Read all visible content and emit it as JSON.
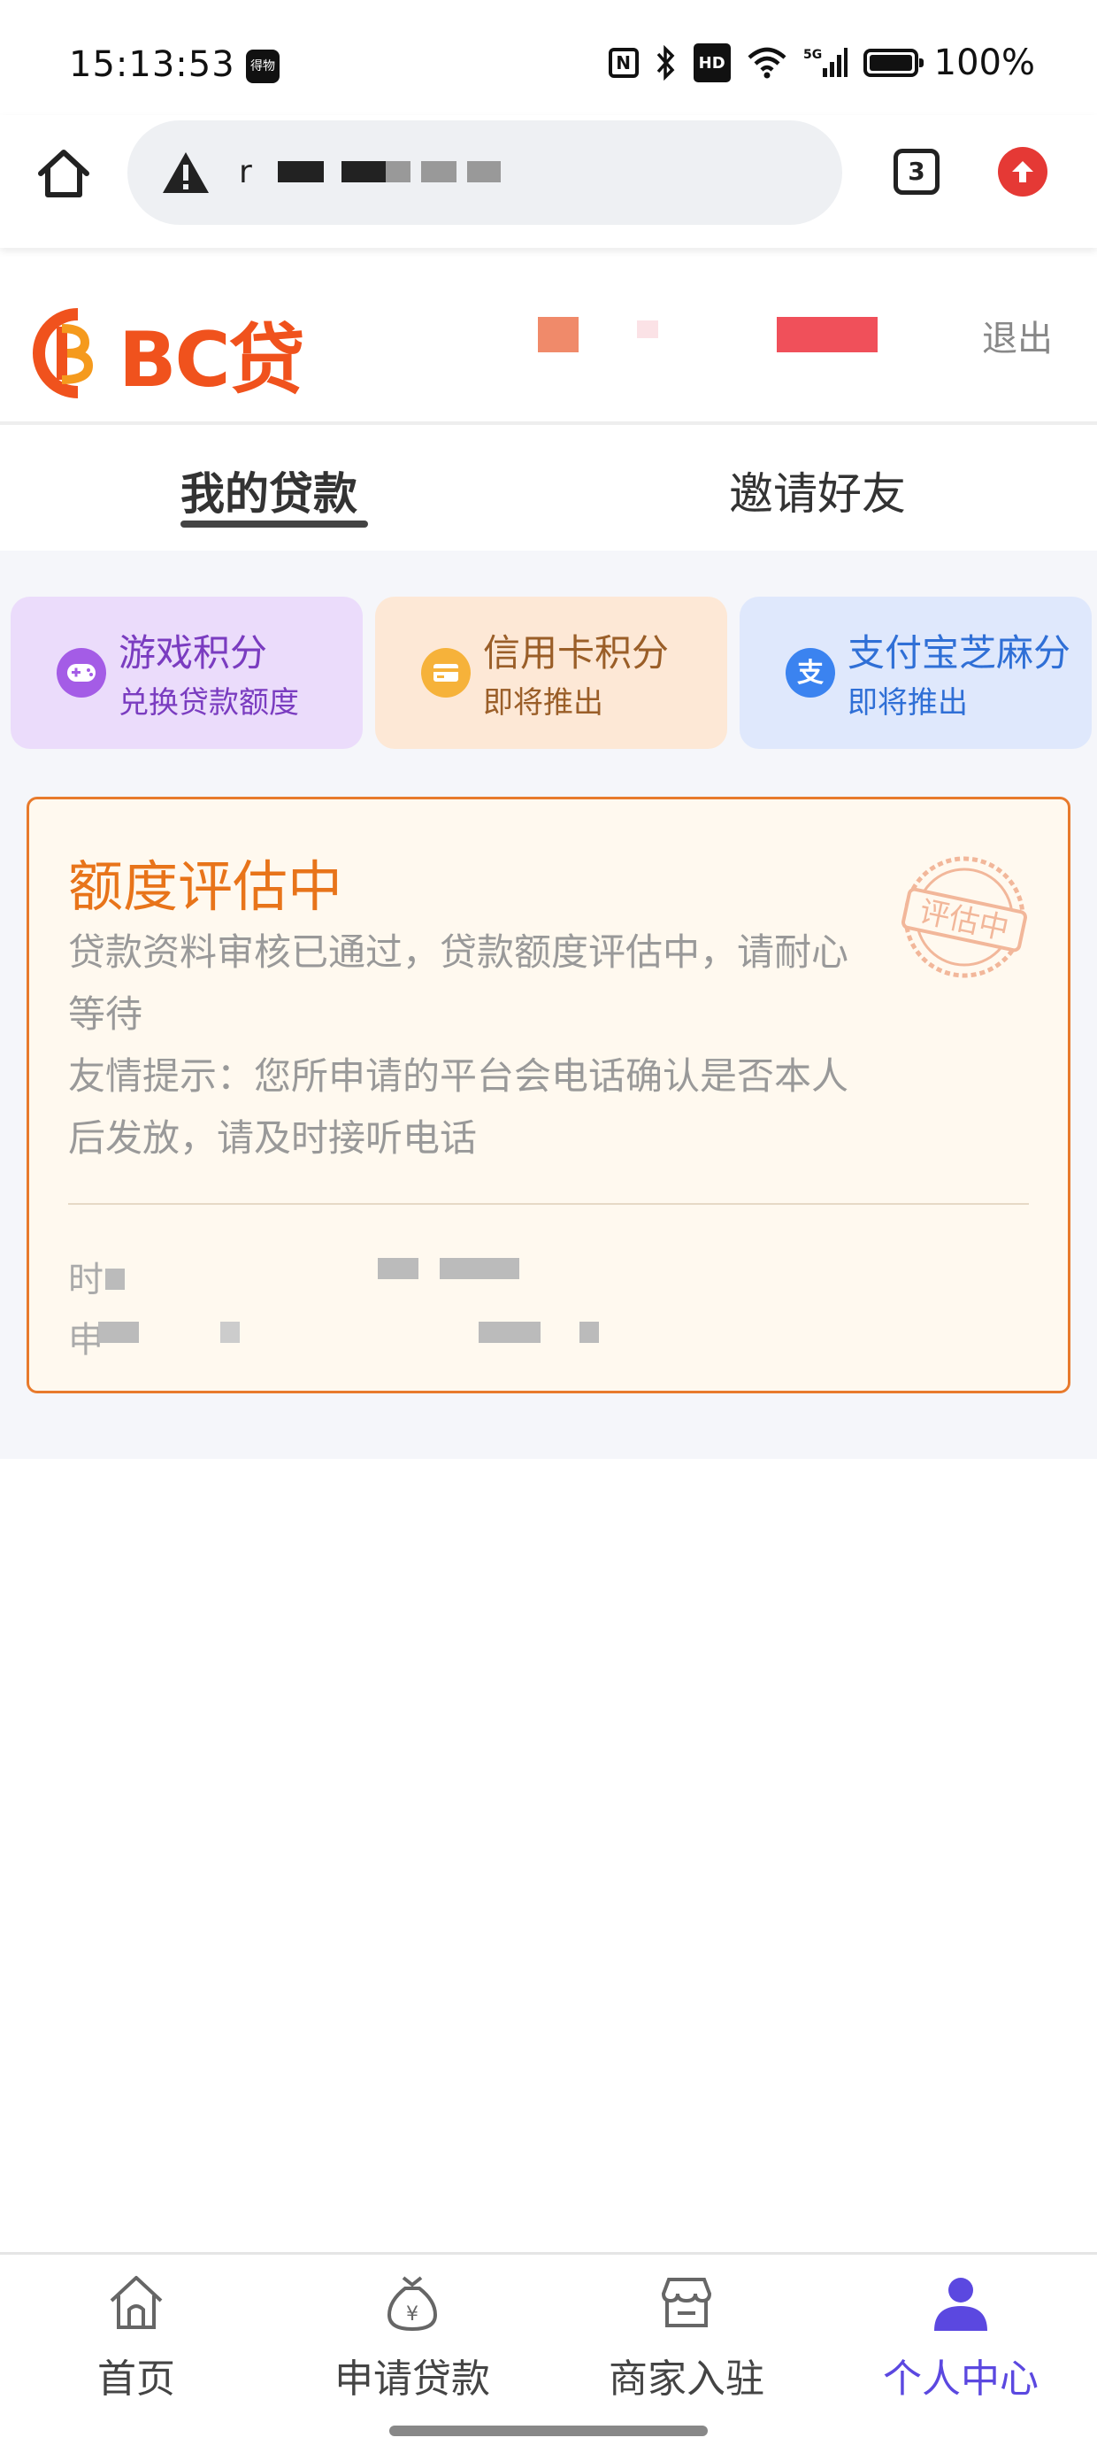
{
  "status_bar": {
    "time": "15:13:53",
    "notif_icon_label": "得物",
    "nfc_label": "N",
    "hd_label": "HD",
    "battery": "100%"
  },
  "browser": {
    "url_prefix": "r",
    "tab_count": "3"
  },
  "header": {
    "logo_text": "BC贷",
    "logout_label": "退出"
  },
  "tabs": [
    {
      "label": "我的贷款",
      "active": true
    },
    {
      "label": "邀请好友",
      "active": false
    }
  ],
  "score_cards": [
    {
      "title": "游戏积分",
      "subtitle": "兑换贷款额度",
      "icon": "gamepad-icon"
    },
    {
      "title": "信用卡积分",
      "subtitle": "即将推出",
      "icon": "credit-card-icon"
    },
    {
      "title": "支付宝芝麻分",
      "subtitle": "即将推出",
      "icon": "alipay-icon"
    }
  ],
  "status_card": {
    "title": "额度评估中",
    "line1": "贷款资料审核已通过，贷款额度评估中，请耐心等待",
    "line2": "友情提示：您所申请的平台会电话确认是否本人后发放，请及时接听电话",
    "stamp_text": "评估中",
    "row1_label": "时",
    "row2_label": "申"
  },
  "bottom_nav": [
    {
      "label": "首页",
      "icon": "home-icon",
      "active": false
    },
    {
      "label": "申请贷款",
      "icon": "money-bag-icon",
      "active": false
    },
    {
      "label": "商家入驻",
      "icon": "store-icon",
      "active": false
    },
    {
      "label": "个人中心",
      "icon": "user-icon",
      "active": true
    }
  ],
  "colors": {
    "brand_orange": "#f0521d",
    "status_orange": "#e8741a",
    "active_nav": "#5b48e0"
  }
}
